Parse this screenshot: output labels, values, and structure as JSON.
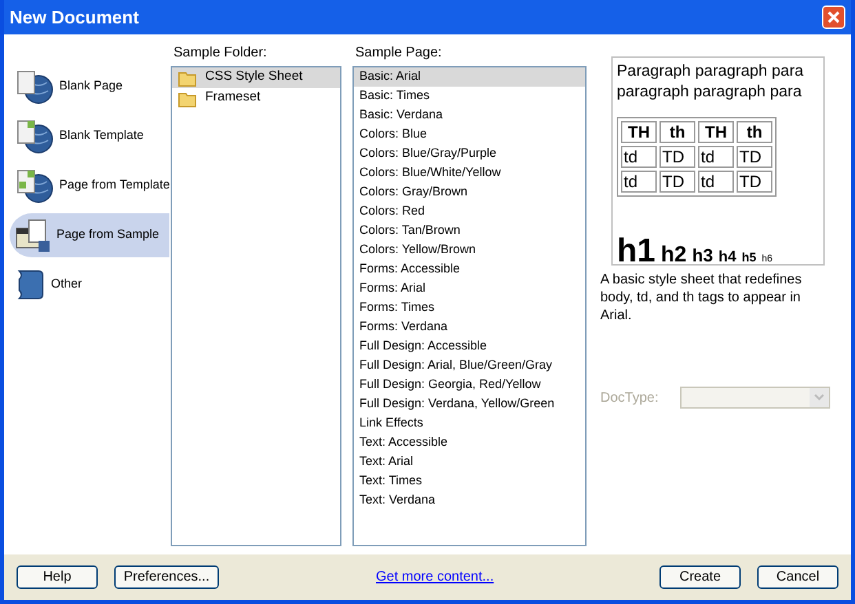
{
  "window": {
    "title": "New Document"
  },
  "categories": [
    {
      "label": "Blank Page",
      "selected": false
    },
    {
      "label": "Blank Template",
      "selected": false
    },
    {
      "label": "Page from Template",
      "selected": false
    },
    {
      "label": "Page from Sample",
      "selected": true
    },
    {
      "label": "Other",
      "selected": false
    }
  ],
  "sample_folder": {
    "label": "Sample Folder:",
    "items": [
      {
        "label": "CSS Style Sheet",
        "selected": true
      },
      {
        "label": "Frameset",
        "selected": false
      }
    ]
  },
  "sample_page": {
    "label": "Sample Page:",
    "items": [
      {
        "label": "Basic: Arial",
        "selected": true
      },
      {
        "label": "Basic: Times",
        "selected": false
      },
      {
        "label": "Basic: Verdana",
        "selected": false
      },
      {
        "label": "Colors: Blue",
        "selected": false
      },
      {
        "label": "Colors: Blue/Gray/Purple",
        "selected": false
      },
      {
        "label": "Colors: Blue/White/Yellow",
        "selected": false
      },
      {
        "label": "Colors: Gray/Brown",
        "selected": false
      },
      {
        "label": "Colors: Red",
        "selected": false
      },
      {
        "label": "Colors: Tan/Brown",
        "selected": false
      },
      {
        "label": "Colors: Yellow/Brown",
        "selected": false
      },
      {
        "label": "Forms: Accessible",
        "selected": false
      },
      {
        "label": "Forms: Arial",
        "selected": false
      },
      {
        "label": "Forms: Times",
        "selected": false
      },
      {
        "label": "Forms: Verdana",
        "selected": false
      },
      {
        "label": "Full Design: Accessible",
        "selected": false
      },
      {
        "label": "Full Design: Arial, Blue/Green/Gray",
        "selected": false
      },
      {
        "label": "Full Design: Georgia, Red/Yellow",
        "selected": false
      },
      {
        "label": "Full Design: Verdana, Yellow/Green",
        "selected": false
      },
      {
        "label": "Link Effects",
        "selected": false
      },
      {
        "label": "Text: Accessible",
        "selected": false
      },
      {
        "label": "Text: Arial",
        "selected": false
      },
      {
        "label": "Text: Times",
        "selected": false
      },
      {
        "label": "Text: Verdana",
        "selected": false
      }
    ]
  },
  "preview": {
    "paragraph_lines": [
      "Paragraph paragraph para",
      "paragraph paragraph para"
    ],
    "table_rows": [
      [
        "TH",
        "th",
        "TH",
        "th"
      ],
      [
        "td",
        "TD",
        "td",
        "TD"
      ],
      [
        "td",
        "TD",
        "td",
        "TD"
      ]
    ],
    "headings": [
      "h1",
      "h2",
      "h3",
      "h4",
      "h5",
      "h6"
    ]
  },
  "description": "A basic style sheet that redefines body, td, and th tags to appear in Arial.",
  "doctype": {
    "label": "DocType:",
    "disabled": true
  },
  "footer": {
    "help": "Help",
    "preferences": "Preferences...",
    "link": "Get more content...",
    "create": "Create",
    "cancel": "Cancel"
  }
}
